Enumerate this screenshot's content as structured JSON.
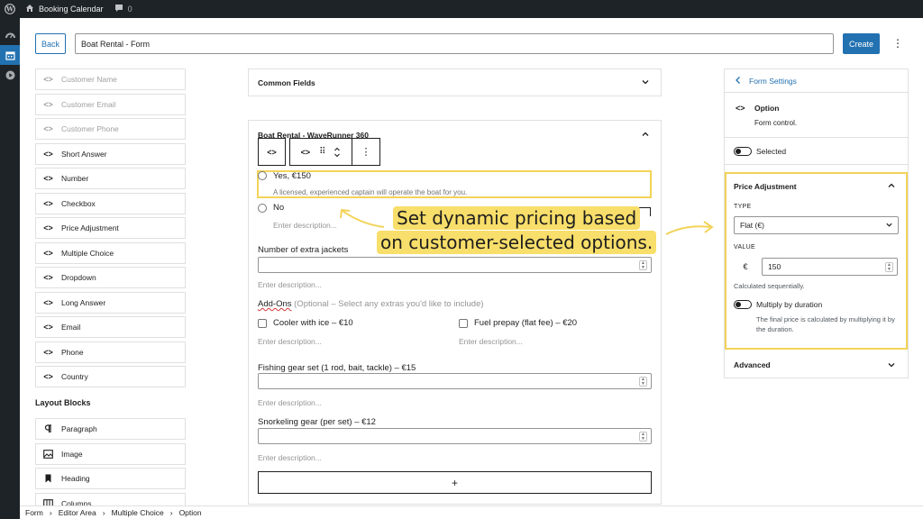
{
  "admin_bar": {
    "site_name": "Booking Calendar",
    "comment_count": "0"
  },
  "top_bar": {
    "back_label": "Back",
    "form_title": "Boat Rental - Form",
    "create_label": "Create"
  },
  "field_list": [
    {
      "label": "Customer Name",
      "icon": "code-icon",
      "dim": true
    },
    {
      "label": "Customer Email",
      "icon": "code-icon",
      "dim": true
    },
    {
      "label": "Customer Phone",
      "icon": "code-icon",
      "dim": true
    },
    {
      "label": "Short Answer",
      "icon": "code-icon",
      "dim": false
    },
    {
      "label": "Number",
      "icon": "code-icon",
      "dim": false
    },
    {
      "label": "Checkbox",
      "icon": "code-icon",
      "dim": false
    },
    {
      "label": "Price Adjustment",
      "icon": "code-icon",
      "dim": false
    },
    {
      "label": "Multiple Choice",
      "icon": "code-icon",
      "dim": false
    },
    {
      "label": "Dropdown",
      "icon": "code-icon",
      "dim": false
    },
    {
      "label": "Long Answer",
      "icon": "code-icon",
      "dim": false
    },
    {
      "label": "Email",
      "icon": "code-icon",
      "dim": false
    },
    {
      "label": "Phone",
      "icon": "code-icon",
      "dim": false
    },
    {
      "label": "Country",
      "icon": "code-icon",
      "dim": false
    }
  ],
  "layout_blocks": {
    "title": "Layout Blocks",
    "items": [
      {
        "label": "Paragraph",
        "icon": "paragraph-icon"
      },
      {
        "label": "Image",
        "icon": "image-icon"
      },
      {
        "label": "Heading",
        "icon": "bookmark-icon"
      },
      {
        "label": "Columns",
        "icon": "columns-icon"
      }
    ]
  },
  "canvas": {
    "common_fields": "Common Fields",
    "form_card_title": "Boat Rental - WaveRunner 360",
    "option_yes": {
      "label": "Yes, €150",
      "desc": "A licensed, experienced captain will operate the boat for you."
    },
    "option_no": {
      "label": "No",
      "desc_placeholder": "Enter description..."
    },
    "extra_jackets": {
      "label": "Number of extra jackets",
      "desc_placeholder": "Enter description..."
    },
    "addons": {
      "label": "Add-Ons",
      "hint": "(Optional – Select any extras you'd like to include)",
      "ice": {
        "label": "Cooler with ice – €10",
        "desc_placeholder": "Enter description..."
      },
      "fuel": {
        "label": "Fuel prepay (flat fee) – €20",
        "desc_placeholder": "Enter description..."
      }
    },
    "fishing": {
      "label": "Fishing gear set (1 rod, bait, tackle) – €15",
      "desc_placeholder": "Enter description..."
    },
    "snorkel": {
      "label": "Snorkeling gear (per set) – €12",
      "desc_placeholder": "Enter description..."
    },
    "add_symbol": "+"
  },
  "callout": {
    "line1": "Set dynamic pricing based",
    "line2": "on customer-selected options."
  },
  "settings": {
    "header": "Form Settings",
    "block_name": "Option",
    "block_desc": "Form control.",
    "selected_label": "Selected",
    "price_adjustment": {
      "title": "Price Adjustment",
      "type_label": "TYPE",
      "type_value": "Flat (€)",
      "value_label": "VALUE",
      "currency": "€",
      "value": "150",
      "calc_note": "Calculated sequentially.",
      "multiply_label": "Multiply by duration",
      "multiply_help": "The final price is calculated by multiplying it by the duration."
    },
    "advanced": "Advanced"
  },
  "breadcrumb": [
    "Form",
    "Editor Area",
    "Multiple Choice",
    "Option"
  ],
  "colors": {
    "accent": "#2271b1",
    "highlight": "#f3d35a",
    "admin_bg": "#1d2327"
  }
}
